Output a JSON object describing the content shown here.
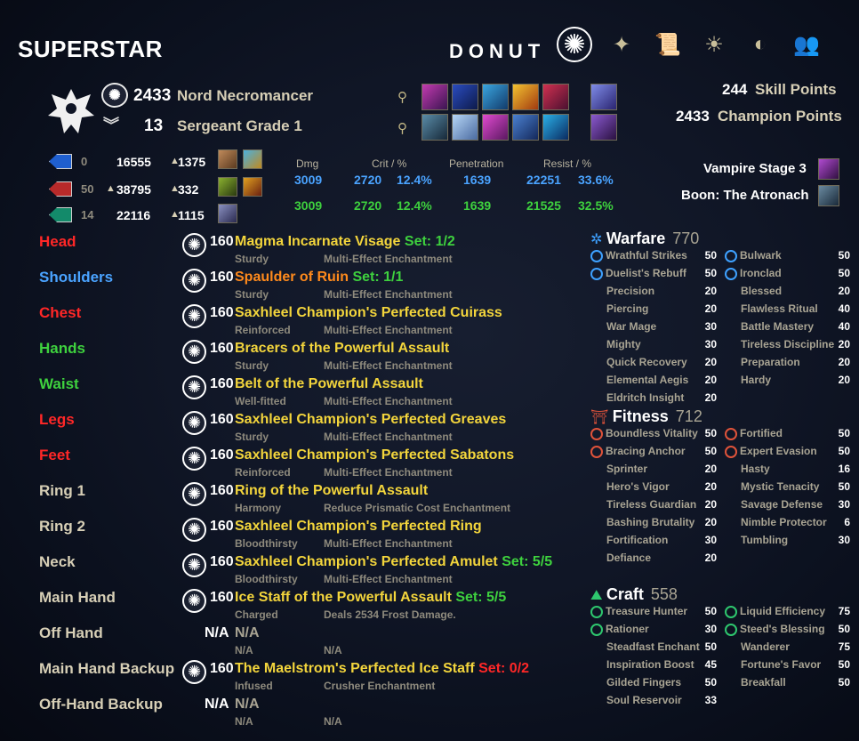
{
  "header": {
    "character_name": "SUPERSTAR",
    "account_name": "DONUT",
    "nav_icons": [
      "champion-icon",
      "skills-icon",
      "scroll-icon",
      "sun-icon",
      "dodge-icon",
      "group-icon"
    ]
  },
  "identity": {
    "level": "2433",
    "race_class": "Nord Necromancer",
    "rank": "13",
    "rank_title": "Sergeant Grade 1"
  },
  "points": {
    "skill_points_value": "244",
    "skill_points_label": "Skill Points",
    "champion_points_value": "2433",
    "champion_points_label": "Champion Points"
  },
  "resources": [
    {
      "color": "#1f5fcf",
      "base": "0",
      "max": "16555",
      "regen_arrow": "▲",
      "regen": "1375",
      "max_arrow": ""
    },
    {
      "color": "#b82a2a",
      "base": "50",
      "max": "38795",
      "regen_arrow": "▲",
      "regen": "332",
      "max_arrow": "▲"
    },
    {
      "color": "#138a6a",
      "base": "14",
      "max": "22116",
      "regen_arrow": "▲",
      "regen": "1115",
      "max_arrow": ""
    }
  ],
  "offense": {
    "headers": {
      "dmg": "Dmg",
      "crit": "Crit / %",
      "pen": "Penetration",
      "resist": "Resist / %"
    },
    "row1": {
      "dmg": "3009",
      "crit": "2720",
      "crit_pct": "12.4%",
      "pen": "1639",
      "resist": "22251",
      "resist_pct": "33.6%"
    },
    "row2": {
      "dmg": "3009",
      "crit": "2720",
      "crit_pct": "12.4%",
      "pen": "1639",
      "resist": "21525",
      "resist_pct": "32.5%"
    }
  },
  "buffs": {
    "vampire": "Vampire Stage 3",
    "boon": "Boon: The Atronach"
  },
  "equipment": [
    {
      "slot": "Head",
      "slot_color": "#ff2727",
      "cp": "160",
      "item": "Magma Incarnate Visage",
      "item_color": "#f3d53c",
      "set": " Set: 1/2",
      "set_color": "#3ed13e",
      "trait": "Sturdy",
      "ench": "Multi-Effect Enchantment",
      "na": false
    },
    {
      "slot": "Shoulders",
      "slot_color": "#4aa3ff",
      "cp": "160",
      "item": "Spaulder of Ruin",
      "item_color": "#ff8a1c",
      "set": " Set: 1/1",
      "set_color": "#3ed13e",
      "trait": "Sturdy",
      "ench": "Multi-Effect Enchantment",
      "na": false
    },
    {
      "slot": "Chest",
      "slot_color": "#ff2727",
      "cp": "160",
      "item": "Saxhleel Champion's Perfected Cuirass",
      "item_color": "#f3d53c",
      "set": "",
      "set_color": "#3ed13e",
      "trait": "Reinforced",
      "ench": "Multi-Effect Enchantment",
      "na": false
    },
    {
      "slot": "Hands",
      "slot_color": "#3ed13e",
      "cp": "160",
      "item": "Bracers of the Powerful Assault",
      "item_color": "#f3d53c",
      "set": "",
      "set_color": "#3ed13e",
      "trait": "Sturdy",
      "ench": "Multi-Effect Enchantment",
      "na": false
    },
    {
      "slot": "Waist",
      "slot_color": "#3ed13e",
      "cp": "160",
      "item": "Belt of the Powerful Assault",
      "item_color": "#f3d53c",
      "set": "",
      "set_color": "#3ed13e",
      "trait": "Well-fitted",
      "ench": "Multi-Effect Enchantment",
      "na": false
    },
    {
      "slot": "Legs",
      "slot_color": "#ff2727",
      "cp": "160",
      "item": "Saxhleel Champion's Perfected Greaves",
      "item_color": "#f3d53c",
      "set": "",
      "set_color": "#3ed13e",
      "trait": "Sturdy",
      "ench": "Multi-Effect Enchantment",
      "na": false
    },
    {
      "slot": "Feet",
      "slot_color": "#ff2727",
      "cp": "160",
      "item": "Saxhleel Champion's Perfected Sabatons",
      "item_color": "#f3d53c",
      "set": "",
      "set_color": "#3ed13e",
      "trait": "Reinforced",
      "ench": "Multi-Effect Enchantment",
      "na": false
    },
    {
      "slot": "Ring 1",
      "slot_color": "#d7cfb6",
      "cp": "160",
      "item": "Ring of the Powerful Assault",
      "item_color": "#f3d53c",
      "set": "",
      "set_color": "#3ed13e",
      "trait": "Harmony",
      "ench": "Reduce Prismatic Cost Enchantment",
      "na": false
    },
    {
      "slot": "Ring 2",
      "slot_color": "#d7cfb6",
      "cp": "160",
      "item": "Saxhleel Champion's Perfected Ring",
      "item_color": "#f3d53c",
      "set": "",
      "set_color": "#3ed13e",
      "trait": "Bloodthirsty",
      "ench": "Multi-Effect Enchantment",
      "na": false
    },
    {
      "slot": "Neck",
      "slot_color": "#d7cfb6",
      "cp": "160",
      "item": "Saxhleel Champion's Perfected Amulet",
      "item_color": "#f3d53c",
      "set": " Set: 5/5",
      "set_color": "#3ed13e",
      "trait": "Bloodthirsty",
      "ench": "Multi-Effect Enchantment",
      "na": false
    },
    {
      "slot": "Main Hand",
      "slot_color": "#d7cfb6",
      "cp": "160",
      "item": "Ice Staff of the Powerful Assault",
      "item_color": "#f3d53c",
      "set": " Set: 5/5",
      "set_color": "#3ed13e",
      "trait": "Charged",
      "ench": "Deals 2534 Frost Damage.",
      "na": false
    },
    {
      "slot": "Off Hand",
      "slot_color": "#d7cfb6",
      "cp": "N/A",
      "item": "N/A",
      "item_color": "#a9a493",
      "set": "",
      "set_color": "#3ed13e",
      "trait": "N/A",
      "ench": "N/A",
      "na": true
    },
    {
      "slot": "Main Hand Backup",
      "slot_color": "#d7cfb6",
      "cp": "160",
      "item": "The Maelstrom's Perfected Ice Staff",
      "item_color": "#f3d53c",
      "set": " Set: 0/2",
      "set_color": "#ff2727",
      "trait": "Infused",
      "ench": "Crusher Enchantment",
      "na": false
    },
    {
      "slot": "Off-Hand Backup",
      "slot_color": "#d7cfb6",
      "cp": "N/A",
      "item": "N/A",
      "item_color": "#a9a493",
      "set": "",
      "set_color": "#3ed13e",
      "trait": "N/A",
      "ench": "N/A",
      "na": true
    }
  ],
  "champion": {
    "warfare": {
      "title": "Warfare",
      "points": "770",
      "color": "#3ea1ff",
      "left": [
        {
          "name": "Wrathful Strikes",
          "value": "50",
          "slotted": true
        },
        {
          "name": "Duelist's Rebuff",
          "value": "50",
          "slotted": true
        },
        {
          "name": "Precision",
          "value": "20",
          "slotted": false
        },
        {
          "name": "Piercing",
          "value": "20",
          "slotted": false
        },
        {
          "name": "War Mage",
          "value": "30",
          "slotted": false
        },
        {
          "name": "Mighty",
          "value": "30",
          "slotted": false
        },
        {
          "name": "Quick Recovery",
          "value": "20",
          "slotted": false
        },
        {
          "name": "Elemental Aegis",
          "value": "20",
          "slotted": false
        },
        {
          "name": "Eldritch Insight",
          "value": "20",
          "slotted": false
        }
      ],
      "right": [
        {
          "name": "Bulwark",
          "value": "50",
          "slotted": true
        },
        {
          "name": "Ironclad",
          "value": "50",
          "slotted": true
        },
        {
          "name": "Blessed",
          "value": "20",
          "slotted": false
        },
        {
          "name": "Flawless Ritual",
          "value": "40",
          "slotted": false
        },
        {
          "name": "Battle Mastery",
          "value": "40",
          "slotted": false
        },
        {
          "name": "Tireless Discipline",
          "value": "20",
          "slotted": false
        },
        {
          "name": "Preparation",
          "value": "20",
          "slotted": false
        },
        {
          "name": "Hardy",
          "value": "20",
          "slotted": false
        }
      ]
    },
    "fitness": {
      "title": "Fitness",
      "points": "712",
      "color": "#e0533a",
      "left": [
        {
          "name": "Boundless Vitality",
          "value": "50",
          "slotted": true
        },
        {
          "name": "Bracing Anchor",
          "value": "50",
          "slotted": true
        },
        {
          "name": "Sprinter",
          "value": "20",
          "slotted": false
        },
        {
          "name": "Hero's Vigor",
          "value": "20",
          "slotted": false
        },
        {
          "name": "Tireless Guardian",
          "value": "20",
          "slotted": false
        },
        {
          "name": "Bashing Brutality",
          "value": "20",
          "slotted": false
        },
        {
          "name": "Fortification",
          "value": "30",
          "slotted": false
        },
        {
          "name": "Defiance",
          "value": "20",
          "slotted": false
        }
      ],
      "right": [
        {
          "name": "Fortified",
          "value": "50",
          "slotted": true
        },
        {
          "name": "Expert Evasion",
          "value": "50",
          "slotted": true
        },
        {
          "name": "Hasty",
          "value": "16",
          "slotted": false
        },
        {
          "name": "Mystic Tenacity",
          "value": "50",
          "slotted": false
        },
        {
          "name": "Savage Defense",
          "value": "30",
          "slotted": false
        },
        {
          "name": "Nimble Protector",
          "value": "6",
          "slotted": false
        },
        {
          "name": "Tumbling",
          "value": "30",
          "slotted": false
        }
      ]
    },
    "craft": {
      "title": "Craft",
      "points": "558",
      "color": "#2ec76e",
      "left": [
        {
          "name": "Treasure Hunter",
          "value": "50",
          "slotted": true
        },
        {
          "name": "Rationer",
          "value": "30",
          "slotted": true
        },
        {
          "name": "Steadfast Enchant",
          "value": "50",
          "slotted": false
        },
        {
          "name": "Inspiration Boost",
          "value": "45",
          "slotted": false
        },
        {
          "name": "Gilded Fingers",
          "value": "50",
          "slotted": false
        },
        {
          "name": "Soul Reservoir",
          "value": "33",
          "slotted": false
        }
      ],
      "right": [
        {
          "name": "Liquid Efficiency",
          "value": "75",
          "slotted": true
        },
        {
          "name": "Steed's Blessing",
          "value": "50",
          "slotted": true
        },
        {
          "name": "Wanderer",
          "value": "75",
          "slotted": false
        },
        {
          "name": "Fortune's Favor",
          "value": "50",
          "slotted": false
        },
        {
          "name": "Breakfall",
          "value": "50",
          "slotted": false
        }
      ]
    }
  }
}
